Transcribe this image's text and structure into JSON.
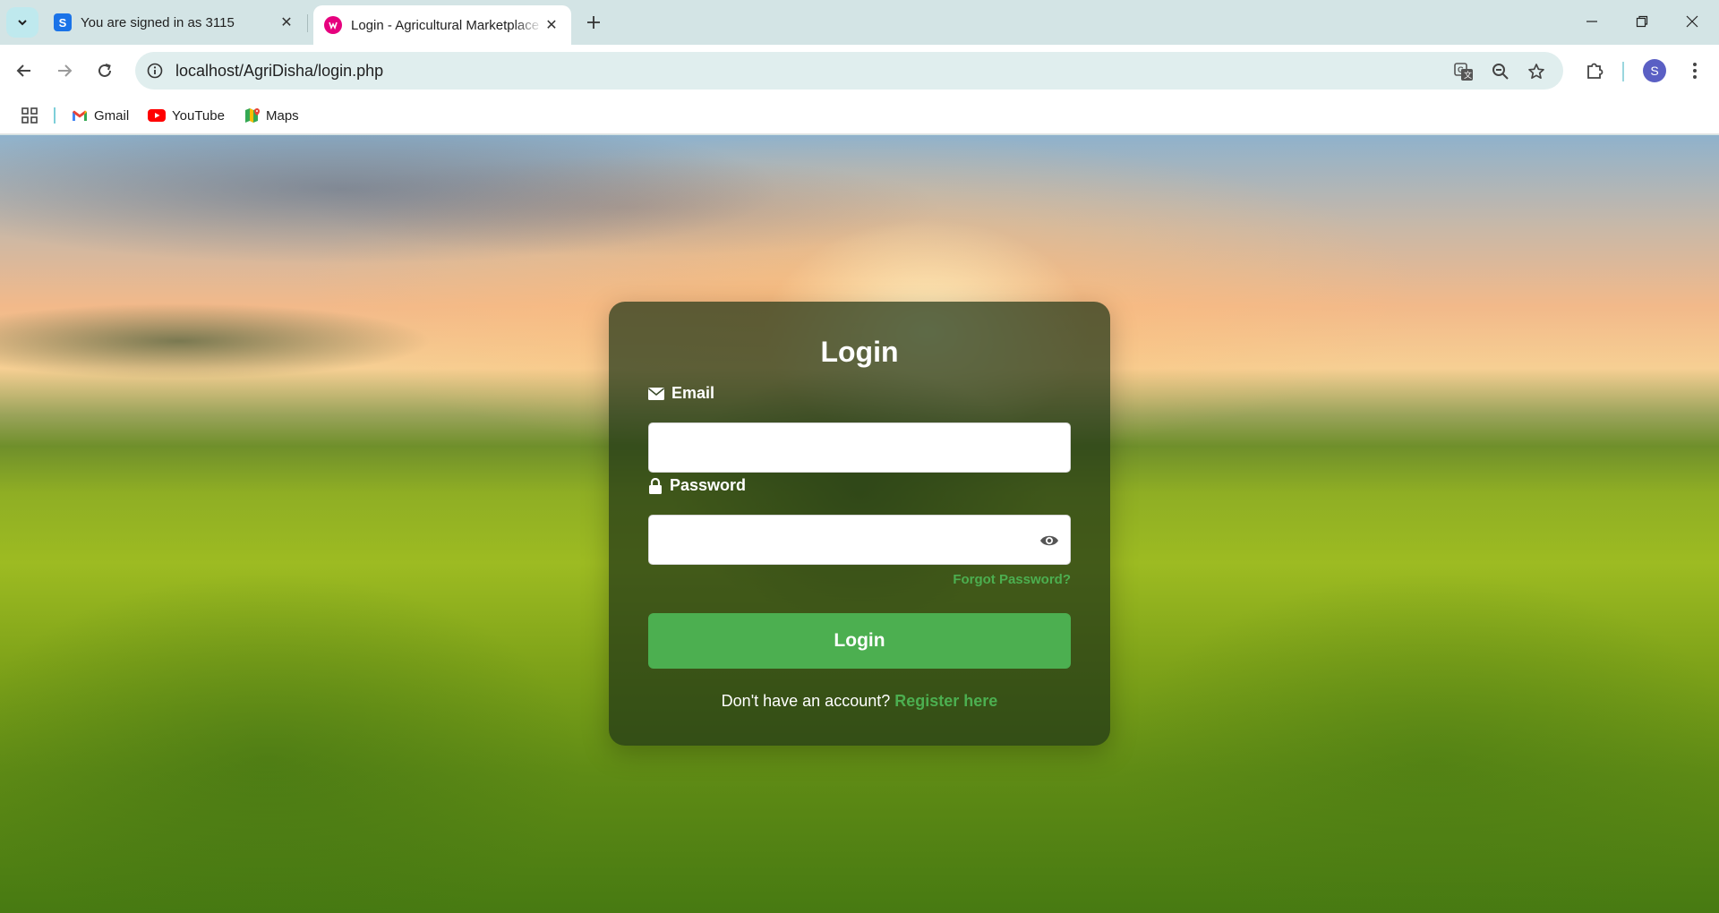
{
  "browser": {
    "tabs": [
      {
        "title": "You are signed in as 3115",
        "favicon": "S",
        "active": false
      },
      {
        "title": "Login - Agricultural Marketplace",
        "favicon": "W",
        "active": true
      }
    ],
    "address": {
      "url": "localhost/AgriDisha/login.php"
    },
    "profile_initial": "S",
    "bookmarks": [
      {
        "label": "Gmail",
        "icon": "gmail-icon"
      },
      {
        "label": "YouTube",
        "icon": "youtube-icon"
      },
      {
        "label": "Maps",
        "icon": "maps-icon"
      }
    ]
  },
  "login": {
    "heading": "Login",
    "email_label": "Email",
    "email_value": "",
    "password_label": "Password",
    "password_value": "",
    "forgot_link": "Forgot Password?",
    "submit_label": "Login",
    "register_prompt": "Don't have an account?",
    "register_link": "Register here"
  },
  "colors": {
    "accent": "#4caf50",
    "card_bg": "rgba(32,52,22,0.72)",
    "tabstrip_bg": "#d3e4e5"
  }
}
